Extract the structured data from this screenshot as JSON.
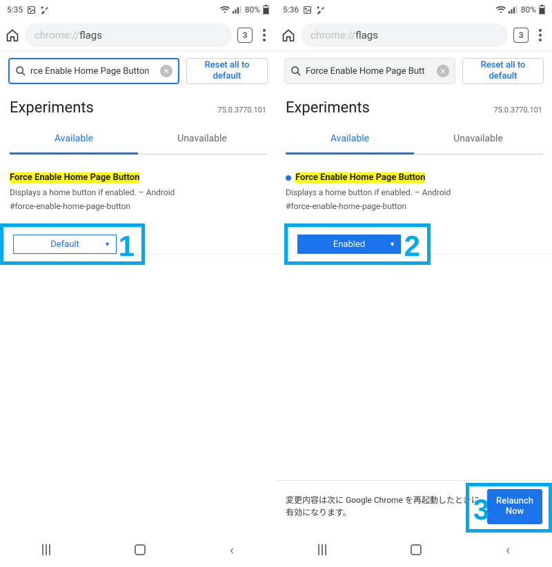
{
  "left": {
    "status": {
      "time": "5:35",
      "battery": "80%"
    },
    "addr": {
      "scheme": "chrome://",
      "path": "flags",
      "tabs": "3"
    },
    "search": {
      "text": "rce Enable Home Page Button"
    },
    "reset": "Reset all to default",
    "experiments": {
      "title": "Experiments",
      "version": "75.0.3770.101"
    },
    "tabs": {
      "available": "Available",
      "unavailable": "Unavailable"
    },
    "flag": {
      "title": "Force Enable Home Page Button",
      "desc": "Displays a home button if enabled. – Android",
      "hash": "#force-enable-home-page-button",
      "select": "Default"
    },
    "callout": "1"
  },
  "right": {
    "status": {
      "time": "5:36",
      "battery": "80%"
    },
    "addr": {
      "scheme": "chrome://",
      "path": "flags",
      "tabs": "3"
    },
    "search": {
      "text": "Force Enable Home Page Butt"
    },
    "reset": "Reset all to default",
    "experiments": {
      "title": "Experiments",
      "version": "75.0.3770.101"
    },
    "tabs": {
      "available": "Available",
      "unavailable": "Unavailable"
    },
    "flag": {
      "title": "Force Enable Home Page Button",
      "desc": "Displays a home button if enabled. – Android",
      "hash": "#force-enable-home-page-button",
      "select": "Enabled"
    },
    "callout2": "2",
    "callout3": "3",
    "relaunch": {
      "msg": "変更内容は次に Google Chrome を再起動したときに有効になります。",
      "btn": "Relaunch Now"
    }
  }
}
